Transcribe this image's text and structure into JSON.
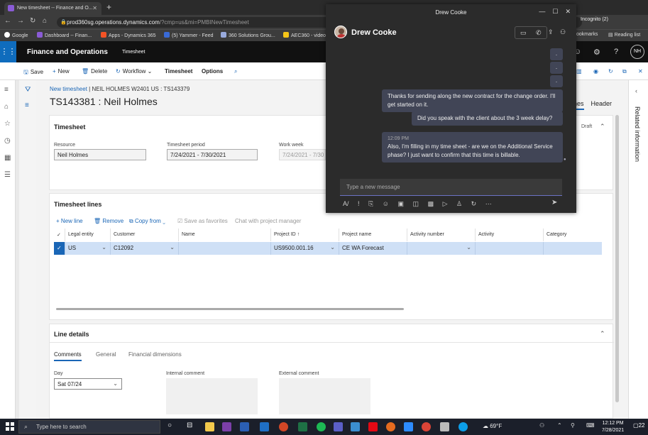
{
  "browser": {
    "tab_title": "New timesheet -- Finance and O...",
    "url_main": "prod360sg.operations.dynamics.com",
    "url_rest": "/?cmp=us&mi=PMBINewTimesheet",
    "incognito": "Incognito (2)",
    "bookmarks": [
      "Google",
      "Dashboard -- Finan...",
      "Apps - Dynamics 365",
      "(5) Yammer - Feed",
      "360 Solutions Grou...",
      "AEC360 - video"
    ],
    "bookmarks_right": "ookmarks",
    "reading_list": "Reading list"
  },
  "d365": {
    "app_name": "Finance and Operations",
    "page_name": "Timesheet",
    "avatar_initials": "NH",
    "actions": {
      "save": "Save",
      "new": "New",
      "delete": "Delete",
      "workflow": "Workflow",
      "timesheet": "Timesheet",
      "options": "Options"
    },
    "breadcrumb_link": "New timesheet",
    "breadcrumb_rest": "| NEIL HOLMES W2401 US : TS143379",
    "title": "TS143381 : Neil Holmes",
    "view_lines": "nes",
    "view_header": "Header",
    "related_info": "Related information",
    "timesheet_card": {
      "title": "Timesheet",
      "resource_label": "Resource",
      "resource_value": "Neil Holmes",
      "period_label": "Timesheet period",
      "period_value": "7/24/2021 - 7/30/2021",
      "workweek_label": "Work week",
      "workweek_value": "7/24/2021 - 7/30",
      "status": "Draft"
    },
    "lines_card": {
      "title": "Timesheet lines",
      "new_line": "New line",
      "remove": "Remove",
      "copy_from": "Copy from",
      "save_favorites": "Save as favorites",
      "chat_pm": "Chat with project manager",
      "columns": [
        "Legal entity",
        "Customer",
        "Name",
        "Project ID",
        "Project name",
        "Activity number",
        "Activity",
        "Category"
      ],
      "row": [
        "US",
        "C12092",
        "",
        "US9500.001.16",
        "CE WA Forecast",
        "",
        "",
        ""
      ]
    },
    "details_card": {
      "title": "Line details",
      "tabs": [
        "Comments",
        "General",
        "Financial dimensions"
      ],
      "day_label": "Day",
      "day_value": "Sat 07/24",
      "internal_label": "Internal comment",
      "external_label": "External comment"
    }
  },
  "teams": {
    "window_title": "Drew Cooke",
    "contact_name": "Drew Cooke",
    "dots": [
      ".",
      ".",
      "."
    ],
    "messages": [
      "Thanks for sending along the new contract for the change order. I'll get started on it.",
      "Did you speak with the client about the 3 week delay?"
    ],
    "incoming_time": "12:09 PM",
    "incoming_text": "Also, I'm filling in my time sheet - are we on the Additional Service phase? I just want to confirm that this time is billable.",
    "compose_placeholder": "Type a new message"
  },
  "taskbar": {
    "search_placeholder": "Type here to search",
    "weather": "69°F",
    "time": "12:12 PM",
    "date": "7/28/2021",
    "notifications": "22"
  }
}
